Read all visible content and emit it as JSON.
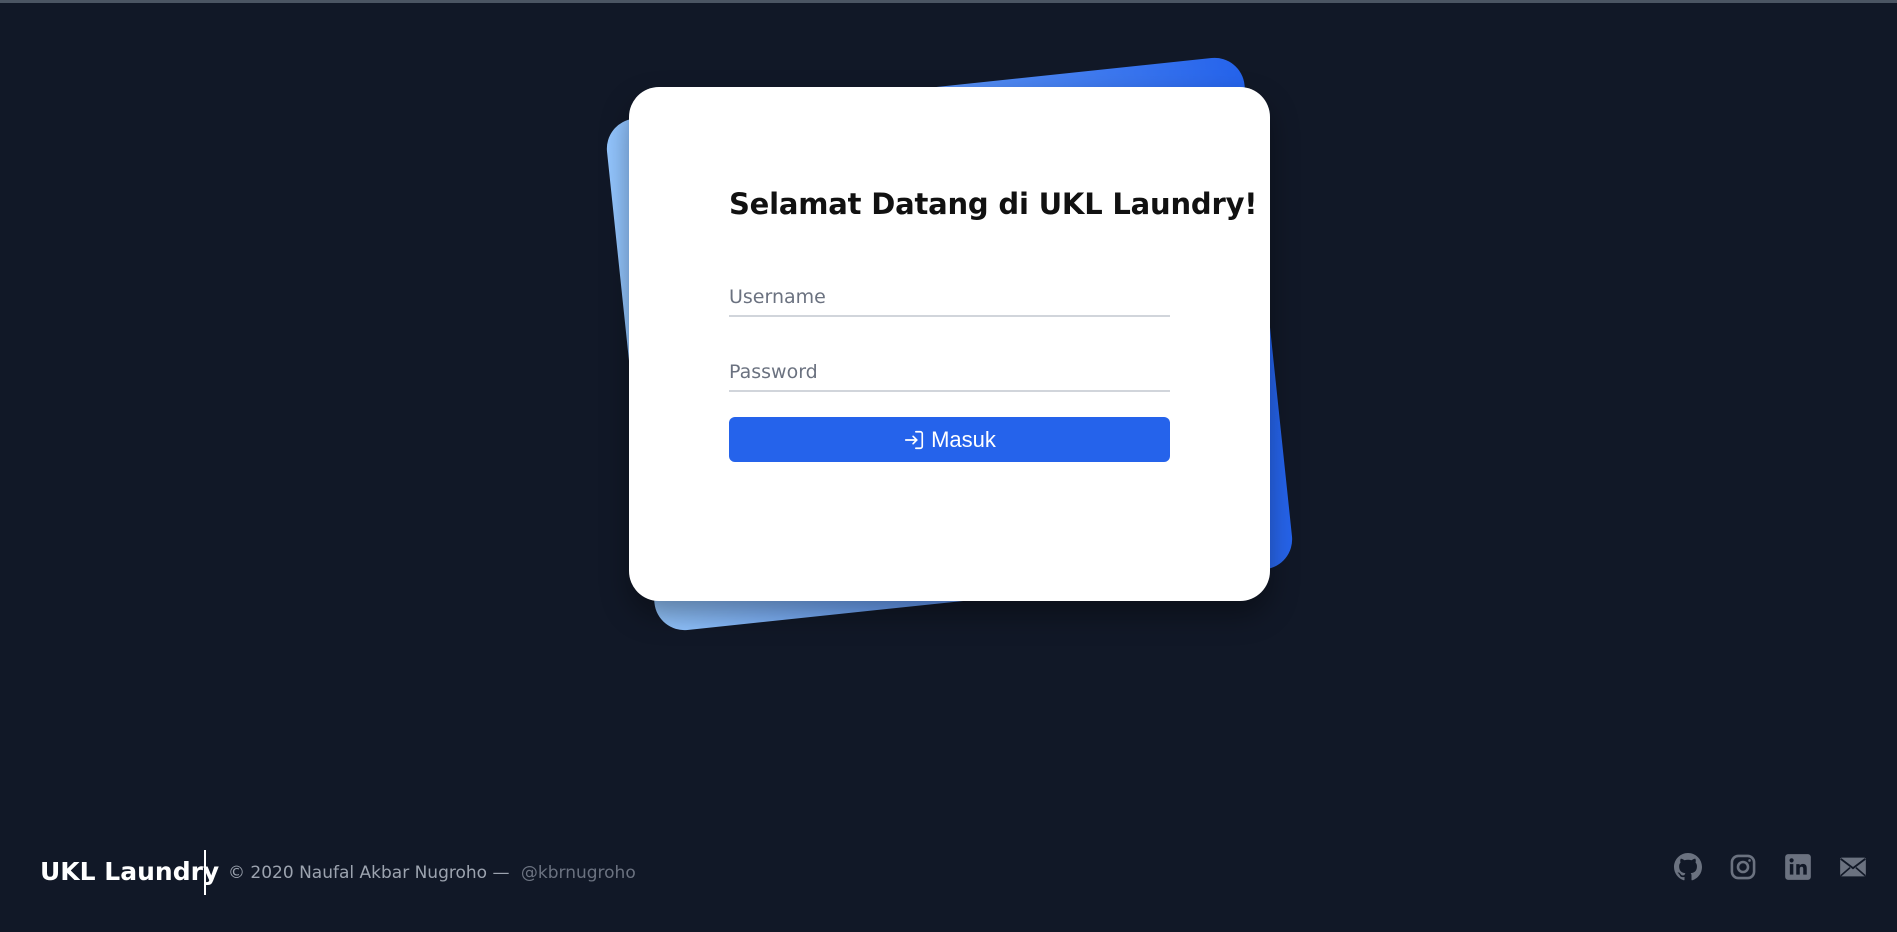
{
  "login": {
    "title": "Selamat Datang di UKL Laundry!",
    "username_placeholder": "Username",
    "password_placeholder": "Password",
    "submit_label": "Masuk",
    "submit_icon": "login-icon"
  },
  "footer": {
    "brand": "UKL Laundry",
    "copyright": "© 2020 Naufal Akbar Nugroho —",
    "handle": "@kbrnugroho",
    "social_icons": [
      "github-icon",
      "instagram-icon",
      "linkedin-icon",
      "mail-icon"
    ]
  },
  "colors": {
    "background": "#111827",
    "accent": "#2563eb",
    "accent_light": "#93c5fd",
    "card": "#ffffff",
    "icon_gray": "#6b7280"
  }
}
